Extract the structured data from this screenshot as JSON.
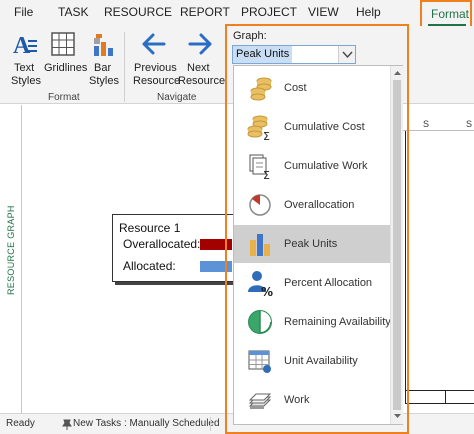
{
  "menu": {
    "items": [
      "File",
      "TASK",
      "RESOURCE",
      "REPORT",
      "PROJECT",
      "VIEW",
      "Help"
    ],
    "active_tab": "Format"
  },
  "ribbon": {
    "text_styles": "Text\nStyles",
    "text_styles_l1": "Text",
    "text_styles_l2": "Styles",
    "gridlines": "Gridlines",
    "bar_styles_l1": "Bar",
    "bar_styles_l2": "Styles",
    "previous_l1": "Previous",
    "previous_l2": "Resource",
    "next_l1": "Next",
    "next_l2": "Resource",
    "group_format": "Format",
    "group_navigate": "Navigate",
    "graph_label": "Graph:",
    "graph_value": "Peak Units"
  },
  "graph_options": [
    {
      "label": "Cost",
      "icon": "coins-icon",
      "selected": false
    },
    {
      "label": "Cumulative Cost",
      "icon": "cumulative-cost-icon",
      "selected": false
    },
    {
      "label": "Cumulative Work",
      "icon": "cumulative-work-icon",
      "selected": false
    },
    {
      "label": "Overallocation",
      "icon": "overallocation-pie-icon",
      "selected": false
    },
    {
      "label": "Peak Units",
      "icon": "peak-units-icon",
      "selected": true
    },
    {
      "label": "Percent Allocation",
      "icon": "percent-allocation-icon",
      "selected": false
    },
    {
      "label": "Remaining Availability",
      "icon": "remaining-availability-icon",
      "selected": false
    },
    {
      "label": "Unit Availability",
      "icon": "calendar-icon",
      "selected": false
    },
    {
      "label": "Work",
      "icon": "work-stack-icon",
      "selected": false
    }
  ],
  "view": {
    "side_label": "RESOURCE GRAPH",
    "timescale": [
      "S",
      "S"
    ]
  },
  "legend": {
    "title": "Resource 1",
    "overallocated": "Overallocated:",
    "allocated": "Allocated:",
    "overallocated_color": "#a30000",
    "allocated_color": "#5b93d6"
  },
  "status": {
    "ready": "Ready",
    "new_tasks": "New Tasks : Manually Scheduled"
  },
  "colors": {
    "accent": "#217346",
    "highlight_frame": "#f07f1d"
  }
}
